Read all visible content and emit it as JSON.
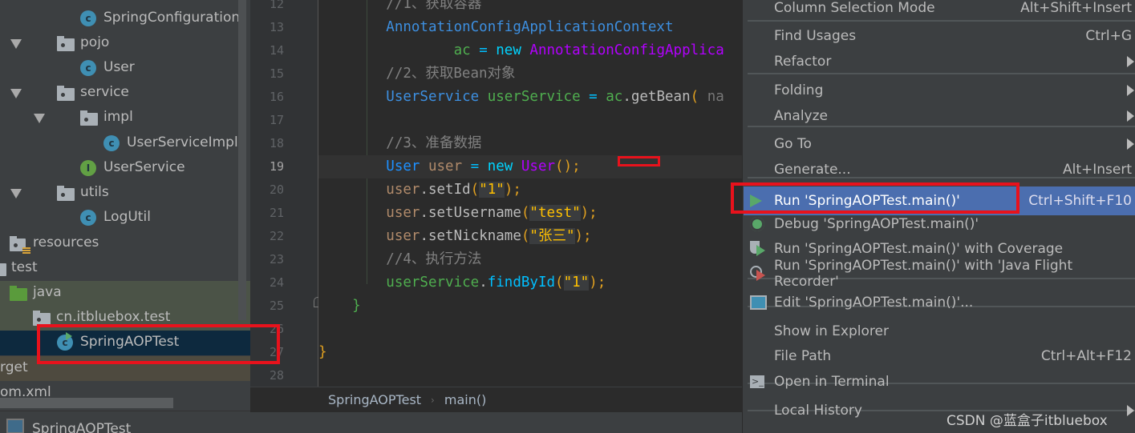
{
  "project_tree": {
    "items": [
      {
        "label": "SpringConfiguration",
        "icon": "class-icon"
      },
      {
        "label": "pojo",
        "icon": "package-icon",
        "expanded": true
      },
      {
        "label": "User",
        "icon": "class-icon"
      },
      {
        "label": "service",
        "icon": "package-icon",
        "expanded": true
      },
      {
        "label": "impl",
        "icon": "package-icon",
        "expanded": true
      },
      {
        "label": "UserServiceImpl",
        "icon": "class-icon"
      },
      {
        "label": "UserService",
        "icon": "interface-icon"
      },
      {
        "label": "utils",
        "icon": "package-icon",
        "expanded": true
      },
      {
        "label": "LogUtil",
        "icon": "class-icon"
      },
      {
        "label": "resources",
        "icon": "resources-folder-icon"
      },
      {
        "label": "test",
        "icon": "folder-icon"
      },
      {
        "label": "java",
        "icon": "test-source-folder-icon"
      },
      {
        "label": "cn.itbluebox.test",
        "icon": "package-icon",
        "expanded": true
      },
      {
        "label": "SpringAOPTest",
        "icon": "runnable-class-icon",
        "selected": true
      },
      {
        "label": "rget",
        "icon": ""
      },
      {
        "label": "om.xml",
        "icon": ""
      }
    ]
  },
  "bottom_tab": {
    "label": "SpringAOPTest"
  },
  "editor": {
    "line_numbers": [
      "12",
      "13",
      "14",
      "15",
      "16",
      "17",
      "18",
      "19",
      "20",
      "21",
      "22",
      "23",
      "24",
      "25",
      "26",
      "27",
      "28"
    ],
    "current_line": "19",
    "lines": [
      [
        {
          "t": "        //1、获取容器",
          "c": "#808080"
        }
      ],
      [
        {
          "t": "        AnnotationConfigApplicationContext",
          "c": "#3d8fe0"
        }
      ],
      [
        {
          "t": "                ac",
          "c": "#4fae4f"
        },
        {
          "t": " = ",
          "c": "#00bfff"
        },
        {
          "t": "new ",
          "c": "#00d4ff"
        },
        {
          "t": "AnnotationConfigApplica",
          "c": "#b300ff"
        }
      ],
      [
        {
          "t": "        //2、获取Bean对象",
          "c": "#808080"
        }
      ],
      [
        {
          "t": "        UserService ",
          "c": "#3d8fe0"
        },
        {
          "t": "userService",
          "c": "#4fae4f"
        },
        {
          "t": " = ",
          "c": "#00bfff"
        },
        {
          "t": "ac",
          "c": "#4fae4f"
        },
        {
          "t": ".getBean",
          "c": "#bbbbbb"
        },
        {
          "t": "( ",
          "c": "#e0a020"
        },
        {
          "t": "na",
          "c": "#777777"
        }
      ],
      [],
      [
        {
          "t": "        //3、准备数据",
          "c": "#808080"
        }
      ],
      [
        {
          "t": "        User ",
          "c": "#1e90ff"
        },
        {
          "t": "user",
          "c": "#b08a6a"
        },
        {
          "t": " = ",
          "c": "#00bfff"
        },
        {
          "t": "new ",
          "c": "#00d4ff"
        },
        {
          "t": "User",
          "c": "#b300ff"
        },
        {
          "t": "();",
          "c": "#e0a020"
        }
      ],
      [
        {
          "t": "        user",
          "c": "#b08a6a"
        },
        {
          "t": ".setId",
          "c": "#bbbbbb"
        },
        {
          "t": "(",
          "c": "#e0a020"
        },
        {
          "t": "\"1\"",
          "c": "#ffc000",
          "s": true
        },
        {
          "t": ");",
          "c": "#e0a020"
        }
      ],
      [
        {
          "t": "        user",
          "c": "#b08a6a"
        },
        {
          "t": ".setUsername",
          "c": "#bbbbbb"
        },
        {
          "t": "(",
          "c": "#e0a020"
        },
        {
          "t": "\"test\"",
          "c": "#ffc000",
          "s": true
        },
        {
          "t": ");",
          "c": "#e0a020"
        }
      ],
      [
        {
          "t": "        user",
          "c": "#b08a6a"
        },
        {
          "t": ".setNickname",
          "c": "#bbbbbb"
        },
        {
          "t": "(",
          "c": "#e0a020"
        },
        {
          "t": "\"张三\"",
          "c": "#ffc000",
          "s": true
        },
        {
          "t": ");",
          "c": "#e0a020"
        }
      ],
      [
        {
          "t": "        //4、执行方法",
          "c": "#808080"
        }
      ],
      [
        {
          "t": "        userService",
          "c": "#4fae4f"
        },
        {
          "t": ".",
          "c": "#bbbbbb"
        },
        {
          "t": "findById",
          "c": "#00bfff"
        },
        {
          "t": "(",
          "c": "#e0a020"
        },
        {
          "t": "\"1\"",
          "c": "#ffc000",
          "s": true
        },
        {
          "t": ");",
          "c": "#e0a020"
        }
      ],
      [
        {
          "t": "    }",
          "c": "#4fae4f"
        }
      ],
      [],
      [
        {
          "t": "}",
          "c": "#e0a020"
        }
      ],
      []
    ]
  },
  "breadcrumb": {
    "items": [
      "SpringAOPTest",
      "main()"
    ]
  },
  "context_menu": {
    "items": [
      {
        "label": "Column Selection Mode",
        "shortcut": "Alt+Shift+Insert"
      },
      {
        "label": "Find Usages",
        "shortcut": "Ctrl+G"
      },
      {
        "label": "Refactor",
        "submenu": true
      },
      {
        "label": "Folding",
        "submenu": true
      },
      {
        "label": "Analyze",
        "submenu": true
      },
      {
        "label": "Go To",
        "submenu": true
      },
      {
        "label": "Generate...",
        "shortcut": "Alt+Insert"
      },
      {
        "label": "Run 'SpringAOPTest.main()'",
        "shortcut": "Ctrl+Shift+F10",
        "icon": "run-icon",
        "highlighted": true
      },
      {
        "label": "Debug 'SpringAOPTest.main()'",
        "icon": "debug-icon"
      },
      {
        "label": "Run 'SpringAOPTest.main()' with Coverage",
        "icon": "coverage-icon"
      },
      {
        "label": "Run 'SpringAOPTest.main()' with 'Java Flight Recorder'",
        "icon": "profiler-icon"
      },
      {
        "label": "Edit 'SpringAOPTest.main()'...",
        "icon": "edit-config-icon"
      },
      {
        "label": "Show in Explorer"
      },
      {
        "label": "File Path",
        "shortcut": "Ctrl+Alt+F12"
      },
      {
        "label": "Open in Terminal",
        "icon": "terminal-icon"
      },
      {
        "label": "Local History",
        "submenu": true
      }
    ]
  },
  "watermark": "CSDN @蓝盒子itbluebox",
  "colors": {
    "highlight": "#4b6eaf",
    "annotation_red": "#e8121c",
    "selection": "#0d293e"
  }
}
